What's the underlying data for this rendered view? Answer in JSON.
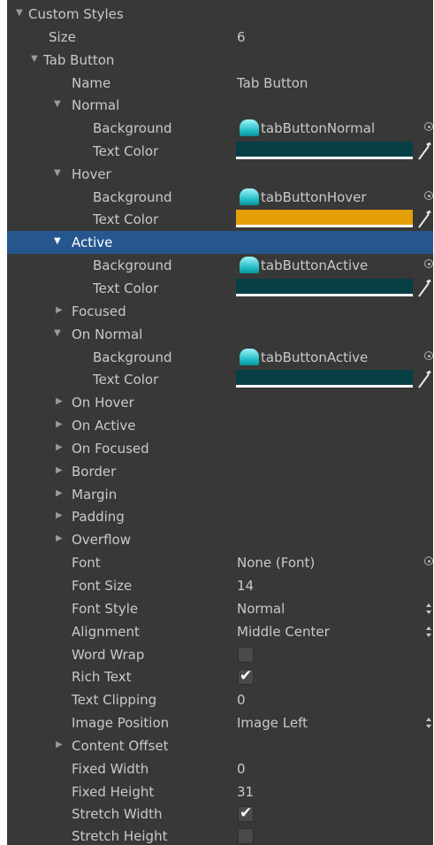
{
  "root": {
    "label": "Custom Styles"
  },
  "size": {
    "label": "Size",
    "value": "6"
  },
  "tab_button": {
    "label": "Tab Button",
    "name": {
      "label": "Name",
      "value": "Tab Button"
    },
    "states": [
      {
        "label": "Normal",
        "expanded": true,
        "background": {
          "label": "Background",
          "value": "tabButtonNormal"
        },
        "text_color": {
          "label": "Text Color",
          "color": "#073f47"
        }
      },
      {
        "label": "Hover",
        "expanded": true,
        "background": {
          "label": "Background",
          "value": "tabButtonHover"
        },
        "text_color": {
          "label": "Text Color",
          "color": "#e4a008"
        }
      },
      {
        "label": "Active",
        "expanded": true,
        "selected": true,
        "background": {
          "label": "Background",
          "value": "tabButtonActive"
        },
        "text_color": {
          "label": "Text Color",
          "color": "#073f47"
        }
      },
      {
        "label": "Focused",
        "expanded": false
      },
      {
        "label": "On Normal",
        "expanded": true,
        "background": {
          "label": "Background",
          "value": "tabButtonActive"
        },
        "text_color": {
          "label": "Text Color",
          "color": "#073f47"
        }
      },
      {
        "label": "On Hover",
        "expanded": false
      },
      {
        "label": "On Active",
        "expanded": false
      },
      {
        "label": "On Focused",
        "expanded": false
      },
      {
        "label": "Border",
        "expanded": false
      },
      {
        "label": "Margin",
        "expanded": false
      },
      {
        "label": "Padding",
        "expanded": false
      },
      {
        "label": "Overflow",
        "expanded": false
      }
    ],
    "font": {
      "label": "Font",
      "value": "None (Font)"
    },
    "font_size": {
      "label": "Font Size",
      "value": "14"
    },
    "font_style": {
      "label": "Font Style",
      "value": "Normal"
    },
    "alignment": {
      "label": "Alignment",
      "value": "Middle Center"
    },
    "word_wrap": {
      "label": "Word Wrap",
      "checked": false
    },
    "rich_text": {
      "label": "Rich Text",
      "checked": true
    },
    "text_clipping": {
      "label": "Text Clipping",
      "value": "0"
    },
    "image_position": {
      "label": "Image Position",
      "value": "Image Left"
    },
    "content_offset": {
      "label": "Content Offset",
      "expanded": false
    },
    "fixed_width": {
      "label": "Fixed Width",
      "value": "0"
    },
    "fixed_height": {
      "label": "Fixed Height",
      "value": "31"
    },
    "stretch_width": {
      "label": "Stretch Width",
      "checked": true
    },
    "stretch_height": {
      "label": "Stretch Height",
      "checked": false
    }
  },
  "icons": {
    "foldout_open": "triangle-down-icon",
    "foldout_closed": "triangle-right-icon",
    "texture": "texture-icon",
    "object_picker": "object-picker-icon",
    "color_picker": "eyedropper-icon",
    "enum_spinner": "dropdown-arrows-icon",
    "checkmark": "checkmark-icon"
  }
}
